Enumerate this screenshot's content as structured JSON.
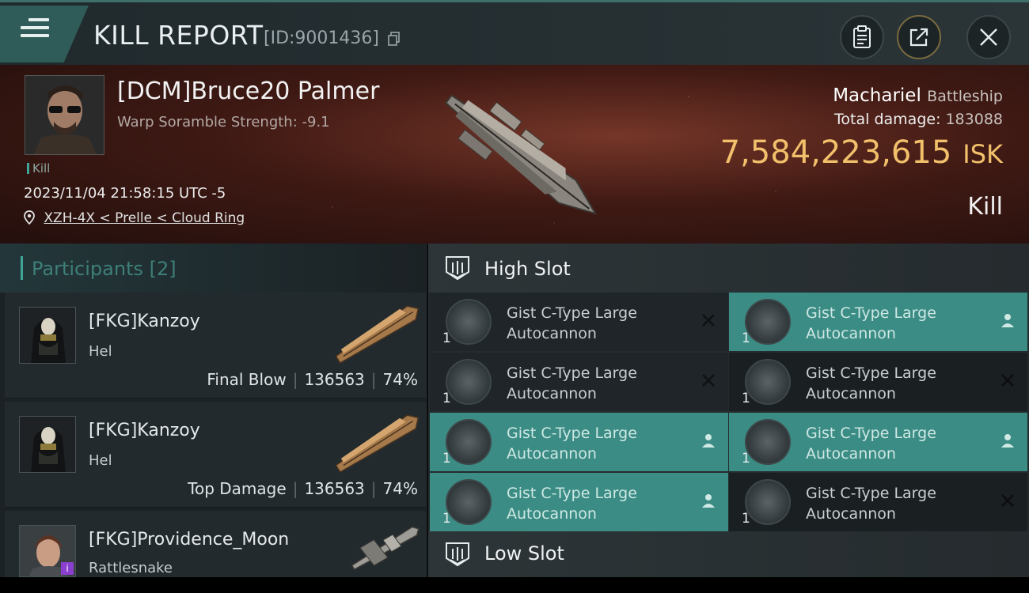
{
  "header": {
    "title": "KILL REPORT",
    "id_label": "[ID:9001436]"
  },
  "victim": {
    "name": "[DCM]Bruce20 Palmer",
    "subtitle": "Warp Soramble Strength: -9.1",
    "tag": "Kill",
    "timestamp": "2023/11/04 21:58:15 UTC -5",
    "location": "XZH-4X < Prelle < Cloud Ring",
    "ship": "Machariel",
    "ship_class": "Battleship",
    "total_damage_label": "Total damage:",
    "total_damage": "183088",
    "isk_value": "7,584,223,615",
    "isk_unit": "ISK",
    "result": "Kill"
  },
  "participants": {
    "title": "Participants [2]",
    "rows": [
      {
        "name": "[FKG]Kanzoy",
        "ship": "Hel",
        "role": "Final Blow",
        "damage": "136563",
        "percent": "74%"
      },
      {
        "name": "[FKG]Kanzoy",
        "ship": "Hel",
        "role": "Top Damage",
        "damage": "136563",
        "percent": "74%"
      },
      {
        "name": "[FKG]Providence_Moon",
        "ship": "Rattlesnake"
      }
    ]
  },
  "fitting": {
    "high_slot_title": "High Slot",
    "low_slot_title": "Low Slot",
    "modules": [
      {
        "line1": "Gist C-Type Large",
        "line2": "Autocannon",
        "qty": "1",
        "flag": "destroyed"
      },
      {
        "line1": "Gist C-Type Large",
        "line2": "Autocannon",
        "qty": "1",
        "flag": "dropped"
      },
      {
        "line1": "Gist C-Type Large",
        "line2": "Autocannon",
        "qty": "1",
        "flag": "destroyed"
      },
      {
        "line1": "Gist C-Type Large",
        "line2": "Autocannon",
        "qty": "1",
        "flag": "destroyed"
      },
      {
        "line1": "Gist C-Type Large",
        "line2": "Autocannon",
        "qty": "1",
        "flag": "dropped"
      },
      {
        "line1": "Gist C-Type Large",
        "line2": "Autocannon",
        "qty": "1",
        "flag": "dropped"
      },
      {
        "line1": "Gist C-Type Large",
        "line2": "Autocannon",
        "qty": "1",
        "flag": "dropped"
      },
      {
        "line1": "Gist C-Type Large",
        "line2": "Autocannon",
        "qty": "1",
        "flag": "destroyed"
      }
    ]
  },
  "colors": {
    "accent_teal": "#3b8c84",
    "isk_gold": "#f2c06b"
  }
}
